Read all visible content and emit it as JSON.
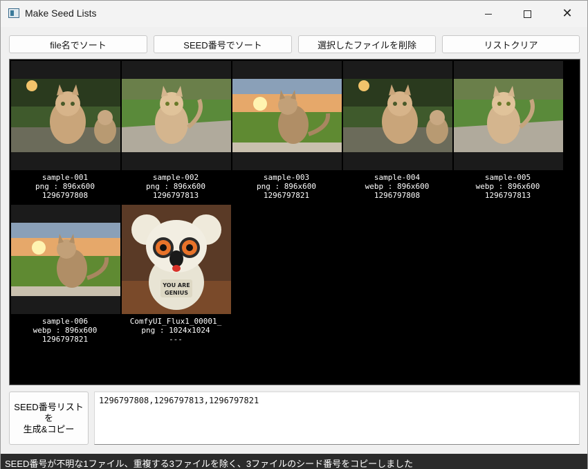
{
  "window": {
    "title": "Make Seed Lists",
    "icon": "app-window-icon"
  },
  "toolbar": {
    "sort_by_filename": "file名でソート",
    "sort_by_seed": "SEED番号でソート",
    "delete_selected": "選択したファイルを削除",
    "clear_list": "リストクリア"
  },
  "thumbnails": [
    {
      "name": "sample-001",
      "info": "png : 896x600",
      "seed": "1296797808",
      "image": "two-cats-lantern"
    },
    {
      "name": "sample-002",
      "info": "png : 896x600",
      "seed": "1296797813",
      "image": "cat-on-path"
    },
    {
      "name": "sample-003",
      "info": "png : 896x600",
      "seed": "1296797821",
      "image": "cat-sunset"
    },
    {
      "name": "sample-004",
      "info": "webp : 896x600",
      "seed": "1296797808",
      "image": "two-cats-lantern"
    },
    {
      "name": "sample-005",
      "info": "webp : 896x600",
      "seed": "1296797813",
      "image": "cat-on-path"
    },
    {
      "name": "sample-006",
      "info": "webp : 896x600",
      "seed": "1296797821",
      "image": "cat-sunset"
    },
    {
      "name": "ComfyUI_Flux1_00001_",
      "info": "png : 1024x1024",
      "seed": "---",
      "image": "koala-you-are-genius"
    }
  ],
  "generate": {
    "button_label": "SEED番号リストを\n生成&コピー",
    "output_text": "1296797808,1296797813,1296797821"
  },
  "status": {
    "message": "SEED番号が不明な1ファイル、重複する3ファイルを除く、3ファイルのシード番号をコピーしました"
  },
  "colors": {
    "grid_background": "#000000",
    "statusbar_background": "#2b2b2b"
  }
}
